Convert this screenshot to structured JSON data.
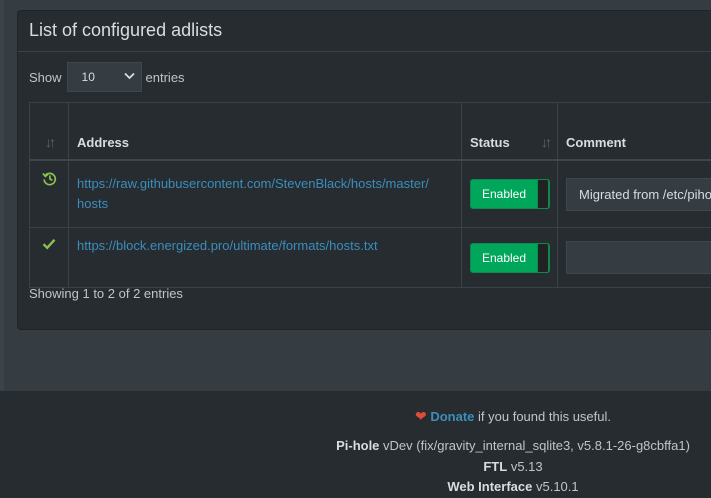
{
  "box": {
    "title": "List of configured adlists"
  },
  "length": {
    "show": "Show",
    "value": "10",
    "entries": "entries"
  },
  "table": {
    "headers": {
      "address": "Address",
      "status": "Status",
      "comment": "Comment"
    },
    "rows": [
      {
        "icon": "history-icon",
        "address_line1": "https://raw.githubusercontent.com/StevenBlack/hosts/master/",
        "address_line2": "hosts",
        "status": "Enabled",
        "comment": "Migrated from /etc/pihole/adlists.list"
      },
      {
        "icon": "check-icon",
        "address_line1": "https://block.energized.pro/ultimate/formats/hosts.txt",
        "address_line2": "",
        "status": "Enabled",
        "comment": ""
      }
    ]
  },
  "info": "Showing 1 to 2 of 2 entries",
  "footer": {
    "donate": "Donate",
    "donate_suffix": "if you found this useful.",
    "pihole_label": "Pi-hole",
    "pihole_version": "vDev (fix/gravity_internal_sqlite3, v5.8.1-26-g8cbffa1)",
    "ftl_label": "FTL",
    "ftl_version": "v5.13",
    "web_label": "Web Interface",
    "web_version": "v5.10.1"
  },
  "colors": {
    "accent": "#3c8dbc",
    "enabled": "#00a65a",
    "heart": "#dd4b39"
  }
}
